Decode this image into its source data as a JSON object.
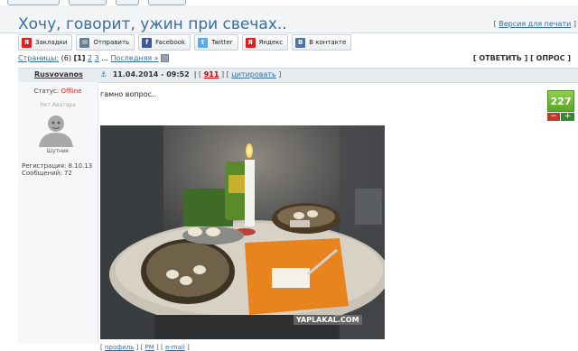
{
  "topic": {
    "title": "Хочу, говорит, ужин при свечах..",
    "print_link": "Версия для печати"
  },
  "share": [
    {
      "label": "Закладки",
      "icon": "yandex-bookmarks-icon",
      "color": "#e02020",
      "glyph": "Я"
    },
    {
      "label": "Отправить",
      "icon": "mail-icon",
      "color": "#6a7c90",
      "glyph": "✉"
    },
    {
      "label": "Facebook",
      "icon": "facebook-icon",
      "color": "#3b5998",
      "glyph": "f"
    },
    {
      "label": "Twitter",
      "icon": "twitter-icon",
      "color": "#55acee",
      "glyph": "t"
    },
    {
      "label": "Яндекс",
      "icon": "yandex-icon",
      "color": "#e02020",
      "glyph": "Я"
    },
    {
      "label": "В контакте",
      "icon": "vkontakte-icon",
      "color": "#4c75a3",
      "glyph": "В"
    }
  ],
  "pager": {
    "label": "Страницы:",
    "total": "(6)",
    "current": "[1]",
    "pages": [
      "2",
      "3"
    ],
    "dots": "...",
    "last": "Последняя »"
  },
  "actions": {
    "reply": "ОТВЕТИТЬ",
    "poll": "ОПРОС"
  },
  "post": {
    "author": "Rusvovanos",
    "date": "11.04.2014 - 09:52",
    "number": "911",
    "cite": "цитировать",
    "text": "гамно вопрос..",
    "rating": "227",
    "rating_minus": "−",
    "rating_plus": "+",
    "watermark": "YAPLAKAL.COM"
  },
  "user": {
    "status_label": "Статус:",
    "status_value": "Offline",
    "no_avatar": "Нет Аватара",
    "rank": "Шутник",
    "reg_label": "Регистрация:",
    "reg_date": "8.10.13",
    "posts_label": "Сообщений:",
    "posts_count": "72"
  },
  "footer": {
    "profile": "профиль",
    "pm": "PM",
    "email": "e-mail"
  }
}
